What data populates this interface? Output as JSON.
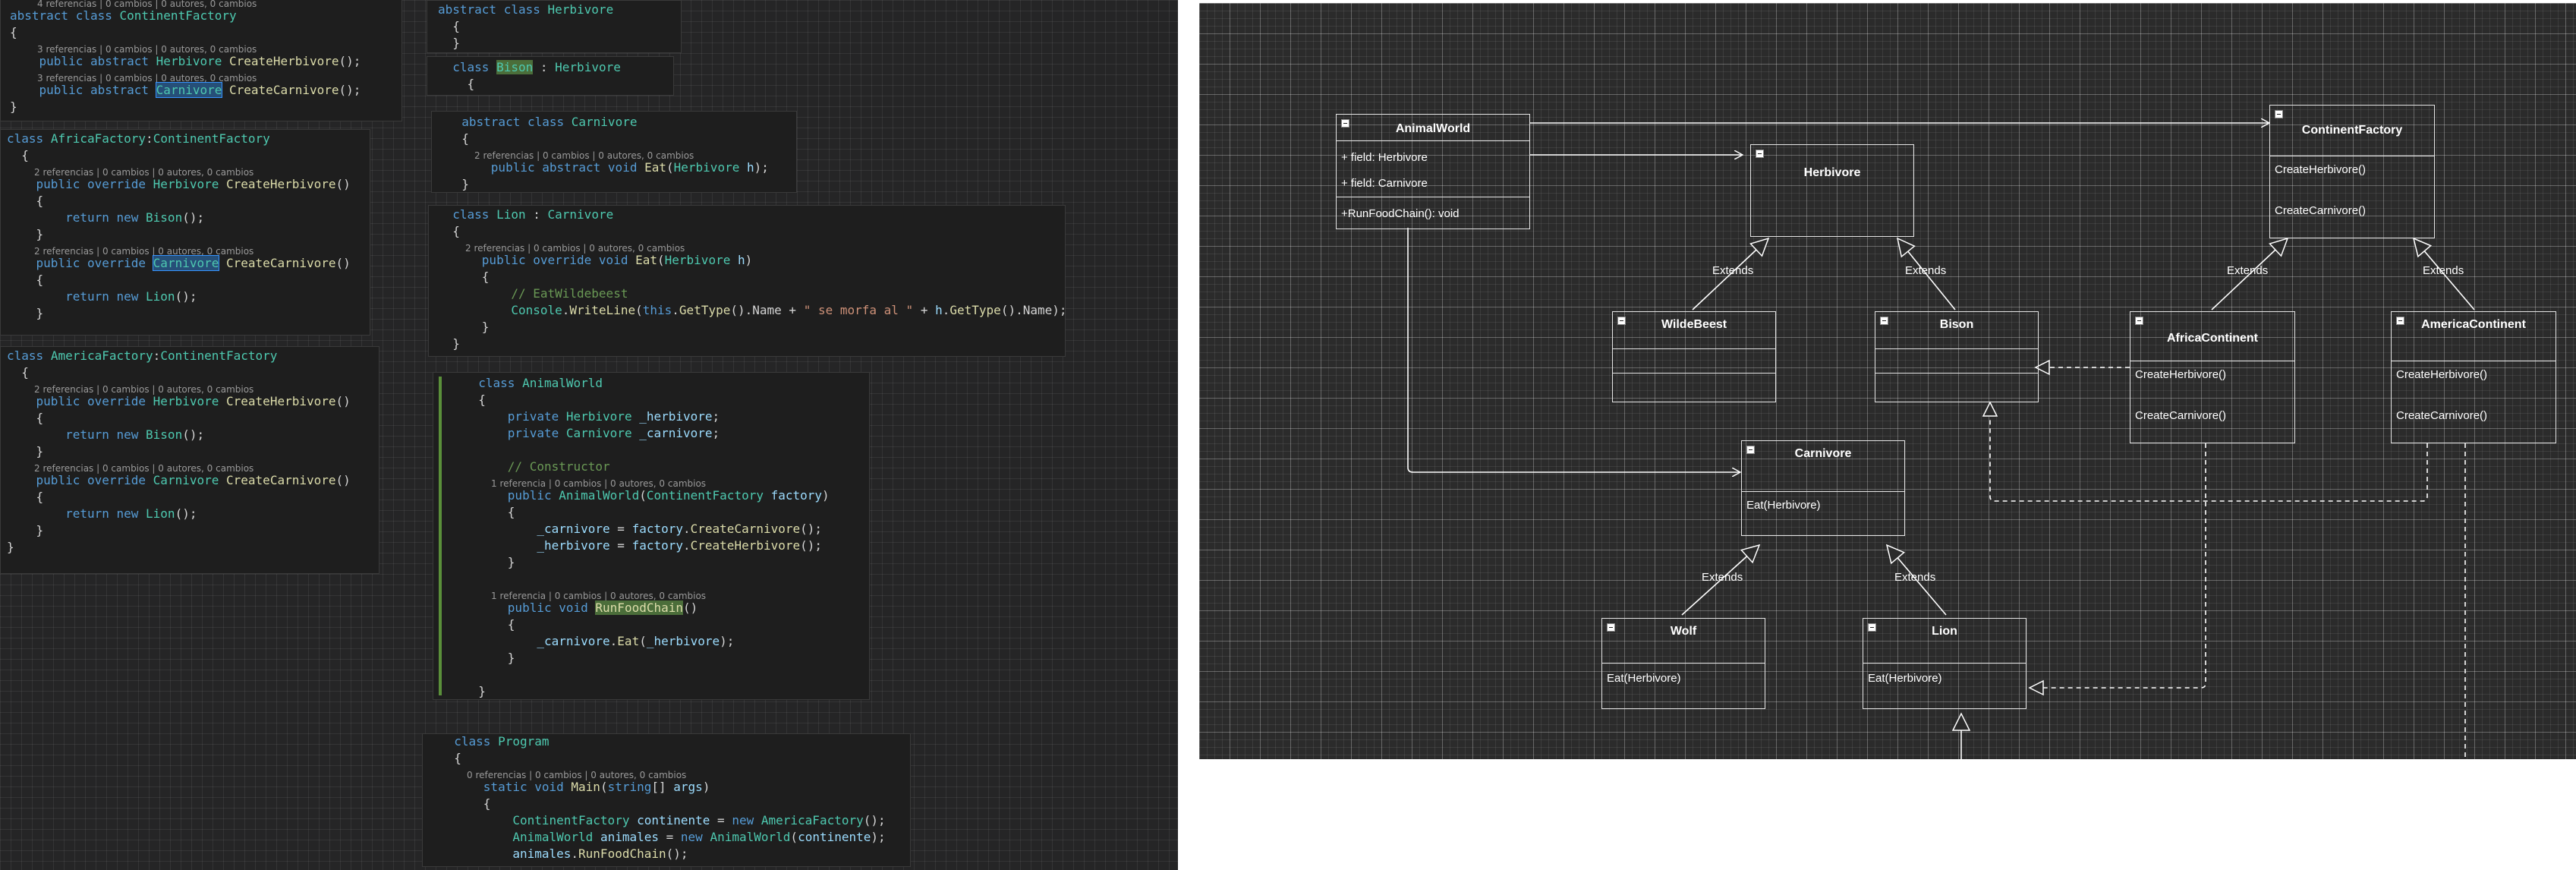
{
  "code": {
    "continent_factory": [
      {
        "t": "lens",
        "s": "4 referencias | 0 cambios | 0 autores, 0 cambios"
      },
      {
        "t": "code",
        "h": "<span class=\"kw\">abstract class</span> <span class=\"ty\">ContinentFactory</span>"
      },
      {
        "t": "code",
        "h": "{"
      },
      {
        "t": "lens",
        "s": "3 referencias | 0 cambios | 0 autores, 0 cambios"
      },
      {
        "t": "code",
        "h": "    <span class=\"kw\">public abstract</span> <span class=\"ty\">Herbivore</span> <span class=\"fn\">CreateHerbivore</span>();"
      },
      {
        "t": "lens",
        "s": "3 referencias | 0 cambios | 0 autores, 0 cambios"
      },
      {
        "t": "code",
        "h": "    <span class=\"kw\">public abstract</span> <span class=\"ty hl\">Carnivore</span> <span class=\"fn\">CreateCarnivore</span>();"
      },
      {
        "t": "code",
        "h": "}"
      }
    ],
    "africa_factory": [
      {
        "t": "code",
        "h": "<span class=\"kw\">class</span> <span class=\"ty\">AfricaFactory</span>:<span class=\"ty\">ContinentFactory</span>"
      },
      {
        "t": "code",
        "h": "  {"
      },
      {
        "t": "lens",
        "s": "2 referencias | 0 cambios | 0 autores, 0 cambios"
      },
      {
        "t": "code",
        "h": "    <span class=\"kw\">public override</span> <span class=\"ty\">Herbivore</span> <span class=\"fn\">CreateHerbivore</span>()"
      },
      {
        "t": "code",
        "h": "    {"
      },
      {
        "t": "code",
        "h": "        <span class=\"kw\">return new</span> <span class=\"ty\">Bison</span>();"
      },
      {
        "t": "code",
        "h": "    }"
      },
      {
        "t": "lens",
        "s": "2 referencias | 0 cambios | 0 autores, 0 cambios"
      },
      {
        "t": "code",
        "h": "    <span class=\"kw\">public override</span> <span class=\"ty hl\">Carnivore</span> <span class=\"fn\">CreateCarnivore</span>()"
      },
      {
        "t": "code",
        "h": "    {"
      },
      {
        "t": "code",
        "h": "        <span class=\"kw\">return new</span> <span class=\"ty\">Lion</span>();"
      },
      {
        "t": "code",
        "h": "    }"
      }
    ],
    "america_factory": [
      {
        "t": "code",
        "h": "<span class=\"kw\">class</span> <span class=\"ty\">AmericaFactory</span>:<span class=\"ty\">ContinentFactory</span>"
      },
      {
        "t": "code",
        "h": "  {"
      },
      {
        "t": "lens",
        "s": "2 referencias | 0 cambios | 0 autores, 0 cambios"
      },
      {
        "t": "code",
        "h": "    <span class=\"kw\">public override</span> <span class=\"ty\">Herbivore</span> <span class=\"fn\">CreateHerbivore</span>()"
      },
      {
        "t": "code",
        "h": "    {"
      },
      {
        "t": "code",
        "h": "        <span class=\"kw\">return new</span> <span class=\"ty\">Bison</span>();"
      },
      {
        "t": "code",
        "h": "    }"
      },
      {
        "t": "lens",
        "s": "2 referencias | 0 cambios | 0 autores, 0 cambios"
      },
      {
        "t": "code",
        "h": "    <span class=\"kw\">public override</span> <span class=\"ty\">Carnivore</span> <span class=\"fn\">CreateCarnivore</span>()"
      },
      {
        "t": "code",
        "h": "    {"
      },
      {
        "t": "code",
        "h": "        <span class=\"kw\">return new</span> <span class=\"ty\">Lion</span>();"
      },
      {
        "t": "code",
        "h": "    }"
      },
      {
        "t": "code",
        "h": "}"
      }
    ],
    "herbivore": [
      {
        "t": "code",
        "h": "<span class=\"kw\">abstract class</span> <span class=\"ty\">Herbivore</span>"
      },
      {
        "t": "code",
        "h": "  {"
      },
      {
        "t": "code",
        "h": "  }"
      }
    ],
    "bison": [
      {
        "t": "code",
        "h": "  <span class=\"kw\">class</span> <span class=\"ty hlg\">Bison</span> : <span class=\"ty\">Herbivore</span>"
      },
      {
        "t": "code",
        "h": "    {"
      },
      {
        "t": "code",
        "h": "    }"
      }
    ],
    "carnivore": [
      {
        "t": "code",
        "h": "  <span class=\"kw\">abstract class</span> <span class=\"ty\">Carnivore</span>"
      },
      {
        "t": "code",
        "h": "  {"
      },
      {
        "t": "lens",
        "s": "2 referencias | 0 cambios | 0 autores, 0 cambios"
      },
      {
        "t": "code",
        "h": "      <span class=\"kw\">public abstract void</span> <span class=\"fn\">Eat</span>(<span class=\"ty\">Herbivore</span> <span class=\"pa\">h</span>);"
      },
      {
        "t": "code",
        "h": "  }"
      }
    ],
    "lion": [
      {
        "t": "code",
        "h": "  <span class=\"kw\">class</span> <span class=\"ty\">Lion</span> : <span class=\"ty\">Carnivore</span>"
      },
      {
        "t": "code",
        "h": "  {"
      },
      {
        "t": "lens",
        "s": "2 referencias | 0 cambios | 0 autores, 0 cambios"
      },
      {
        "t": "code",
        "h": "      <span class=\"kw\">public override void</span> <span class=\"fn\">Eat</span>(<span class=\"ty\">Herbivore</span> <span class=\"pa\">h</span>)"
      },
      {
        "t": "code",
        "h": "      {"
      },
      {
        "t": "code",
        "h": "          <span class=\"cm\">// EatWildebeest</span>"
      },
      {
        "t": "code",
        "h": "          <span class=\"ty\">Console</span>.<span class=\"fn\">WriteLine</span>(<span class=\"kw\">this</span>.<span class=\"fn\">GetType</span>().Name + <span class=\"st\">\" se morfa al \"</span> + <span class=\"pa\">h</span>.<span class=\"fn\">GetType</span>().Name);"
      },
      {
        "t": "code",
        "h": "      }"
      },
      {
        "t": "code",
        "h": "  }"
      }
    ],
    "animal_world": [
      {
        "t": "code",
        "h": "  <span class=\"kw\">class</span> <span class=\"ty\">AnimalWorld</span>"
      },
      {
        "t": "code",
        "h": "  {"
      },
      {
        "t": "code",
        "h": "      <span class=\"kw\">private</span> <span class=\"ty\">Herbivore</span> <span class=\"pa\">_herbivore</span>;"
      },
      {
        "t": "code",
        "h": "      <span class=\"kw\">private</span> <span class=\"ty\">Carnivore</span> <span class=\"pa\">_carnivore</span>;"
      },
      {
        "t": "code",
        "h": ""
      },
      {
        "t": "code",
        "h": "      <span class=\"cm\">// Constructor</span>"
      },
      {
        "t": "lens",
        "s": "1 referencia | 0 cambios | 0 autores, 0 cambios"
      },
      {
        "t": "code",
        "h": "      <span class=\"kw\">public</span> <span class=\"ty\">AnimalWorld</span>(<span class=\"ty\">ContinentFactory</span> <span class=\"pa\">factory</span>)"
      },
      {
        "t": "code",
        "h": "      {"
      },
      {
        "t": "code",
        "h": "          <span class=\"pa\">_carnivore</span> = <span class=\"pa\">factory</span>.<span class=\"fn\">CreateCarnivore</span>();"
      },
      {
        "t": "code",
        "h": "          <span class=\"pa\">_herbivore</span> = <span class=\"pa\">factory</span>.<span class=\"fn\">CreateHerbivore</span>();"
      },
      {
        "t": "code",
        "h": "      }"
      },
      {
        "t": "code",
        "h": ""
      },
      {
        "t": "lens",
        "s": "1 referencia | 0 cambios | 0 autores, 0 cambios"
      },
      {
        "t": "code",
        "h": "      <span class=\"kw\">public void</span> <span class=\"fn hlg\">RunFoodChain</span>()"
      },
      {
        "t": "code",
        "h": "      {"
      },
      {
        "t": "code",
        "h": "          <span class=\"pa\">_carnivore</span>.<span class=\"fn\">Eat</span>(<span class=\"pa\">_herbivore</span>);"
      },
      {
        "t": "code",
        "h": "      }"
      },
      {
        "t": "code",
        "h": ""
      },
      {
        "t": "code",
        "h": "  }"
      }
    ],
    "program": [
      {
        "t": "code",
        "h": "  <span class=\"kw\">class</span> <span class=\"ty\">Program</span>"
      },
      {
        "t": "code",
        "h": "  {"
      },
      {
        "t": "lens",
        "s": "0 referencias | 0 cambios | 0 autores, 0 cambios"
      },
      {
        "t": "code",
        "h": "      <span class=\"kw\">static void</span> <span class=\"fn\">Main</span>(<span class=\"kw\">string</span>[] <span class=\"pa\">args</span>)"
      },
      {
        "t": "code",
        "h": "      {"
      },
      {
        "t": "code",
        "h": "          <span class=\"ty\">ContinentFactory</span> <span class=\"pa\">continente</span> = <span class=\"kw\">new</span> <span class=\"ty\">AmericaFactory</span>();"
      },
      {
        "t": "code",
        "h": "          <span class=\"ty\">AnimalWorld</span> <span class=\"pa\">animales</span> = <span class=\"kw\">new</span> <span class=\"ty\">AnimalWorld</span>(<span class=\"pa\">continente</span>);"
      },
      {
        "t": "code",
        "h": "          <span class=\"pa\">animales</span>.<span class=\"fn\">RunFoodChain</span>();"
      }
    ]
  },
  "uml": {
    "animal_world": {
      "title": "AnimalWorld",
      "field1": "+ field: Herbivore",
      "field2": "+ field: Carnivore",
      "method": "+RunFoodChain(): void"
    },
    "herbivore": {
      "title": "Herbivore"
    },
    "continent_factory": {
      "title": "ContinentFactory",
      "m1": "CreateHerbivore()",
      "m2": "CreateCarnivore()"
    },
    "wildebeest": {
      "title": "WildeBeest"
    },
    "bison": {
      "title": "Bison"
    },
    "africa_continent": {
      "title": "AfricaContinent",
      "m1": "CreateHerbivore()",
      "m2": "CreateCarnivore()"
    },
    "america_continent": {
      "title": "AmericaContinent",
      "m1": "CreateHerbivore()",
      "m2": "CreateCarnivore()"
    },
    "carnivore": {
      "title": "Carnivore",
      "m1": "Eat(Herbivore)"
    },
    "wolf": {
      "title": "Wolf",
      "m1": "Eat(Herbivore)"
    },
    "lion": {
      "title": "Lion",
      "m1": "Eat(Herbivore)"
    },
    "extends_label": "Extends"
  }
}
